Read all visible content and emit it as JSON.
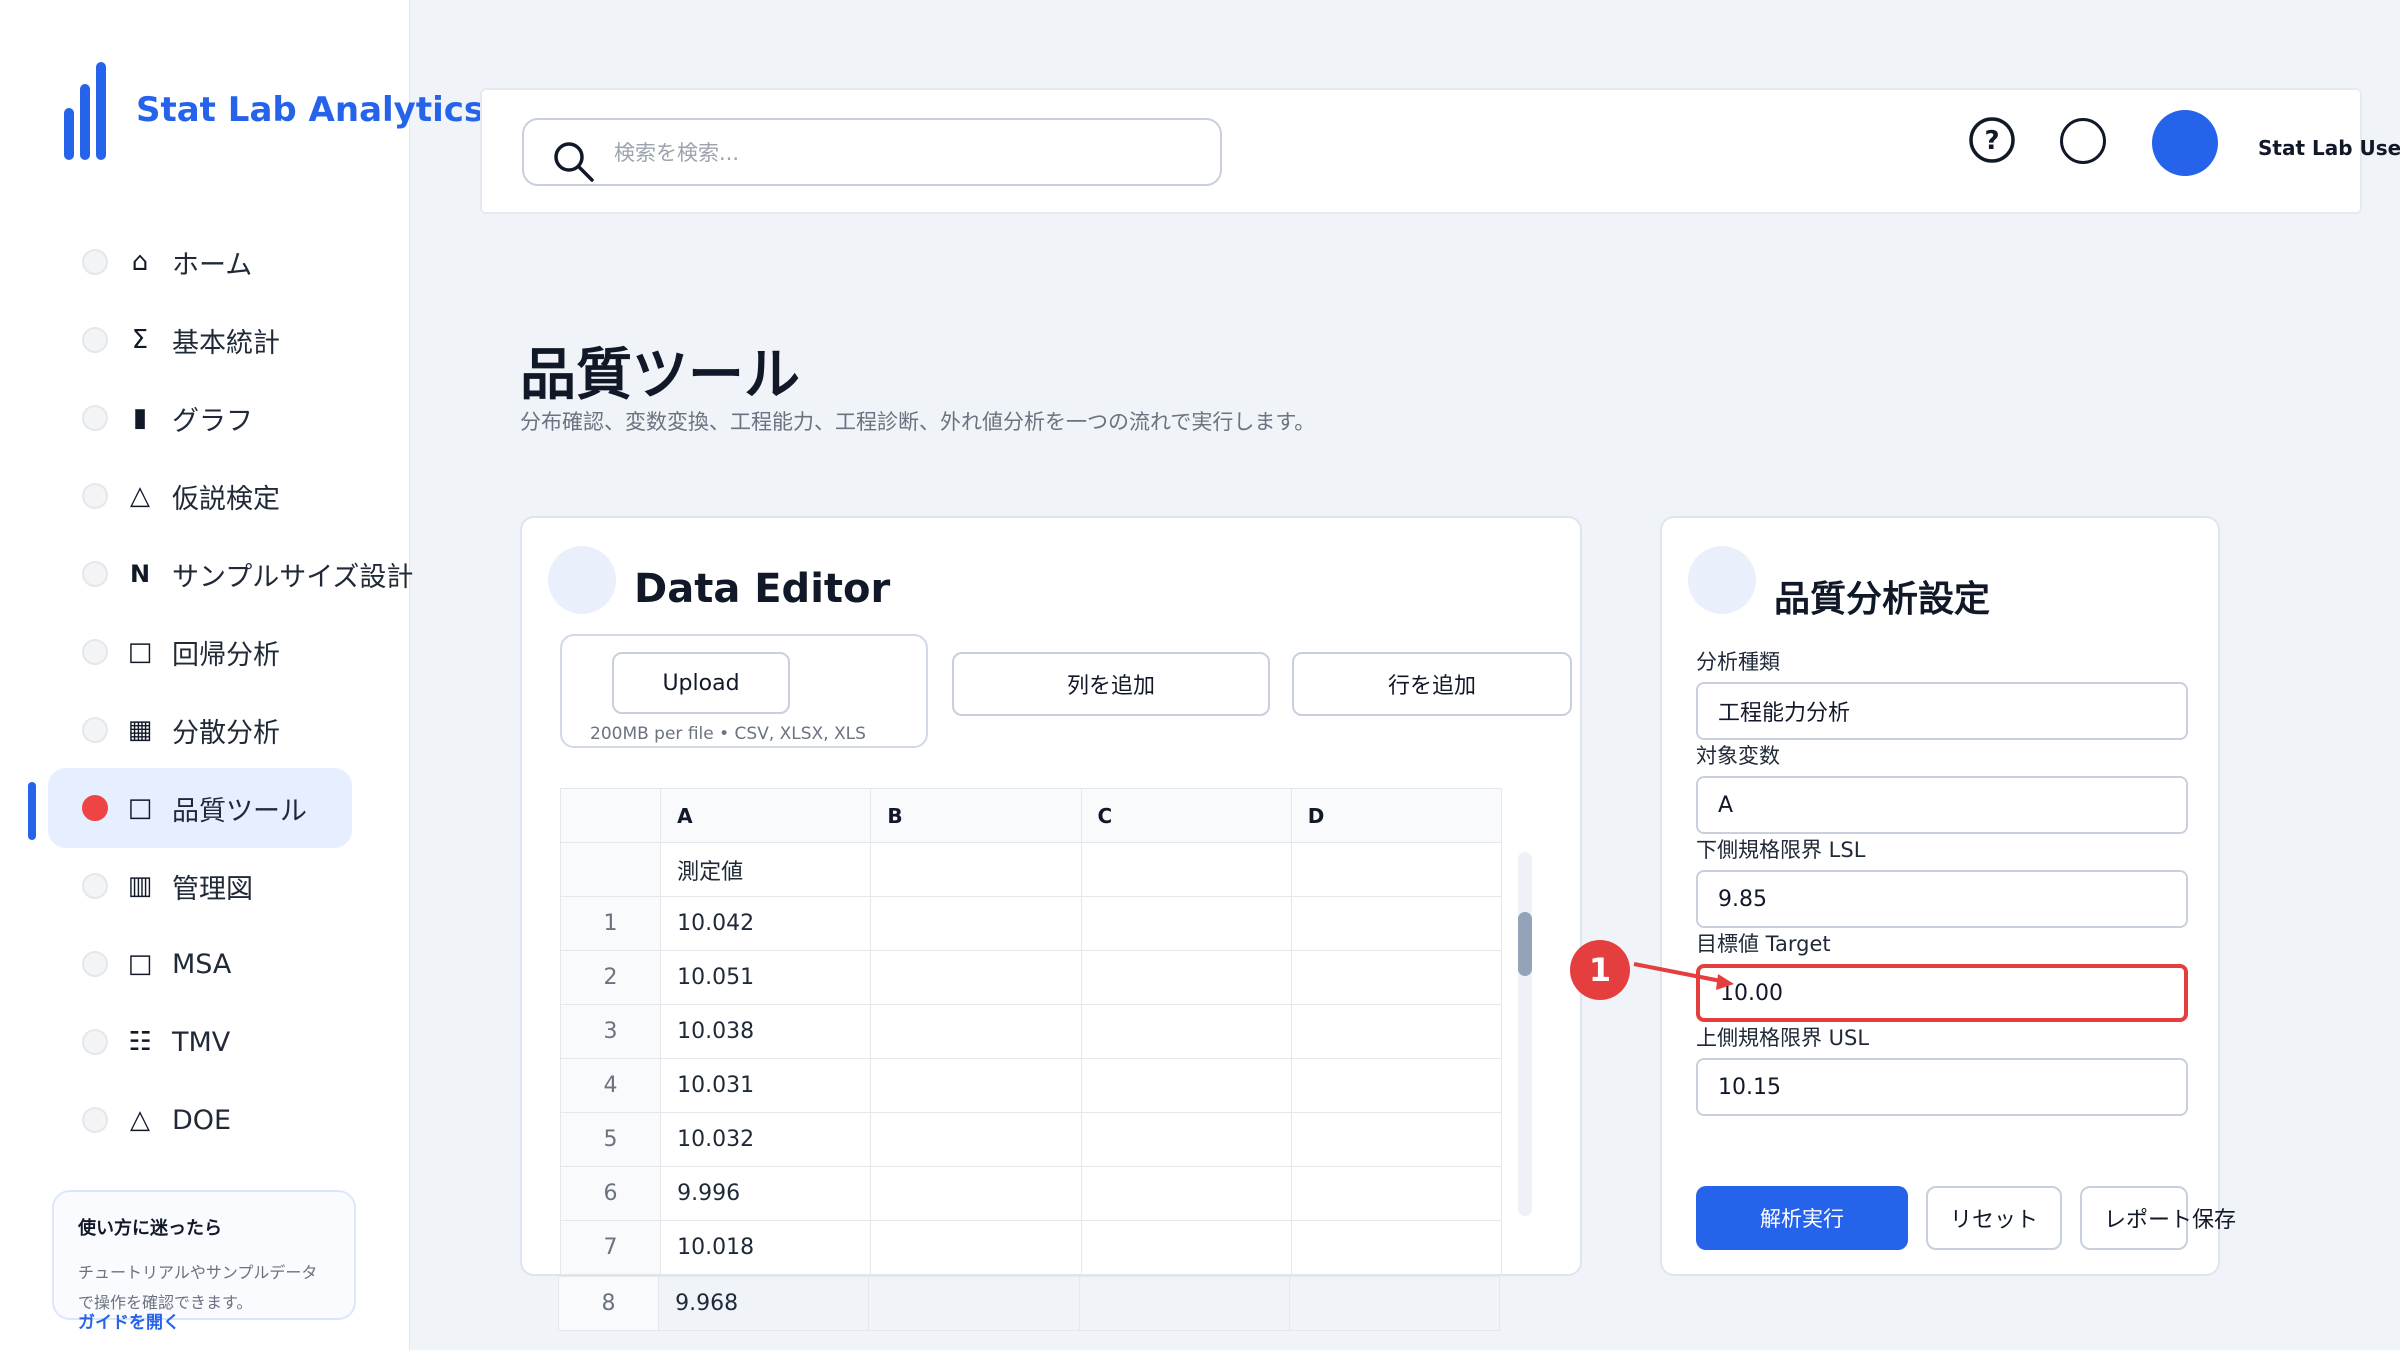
{
  "brand": {
    "name": "Stat Lab Analytics"
  },
  "sidebar": {
    "items": [
      {
        "icon": "⌂",
        "label": "ホーム"
      },
      {
        "icon": "Σ",
        "label": "基本統計"
      },
      {
        "icon": "▮",
        "label": "グラフ"
      },
      {
        "icon": "△",
        "label": "仮説検定"
      },
      {
        "icon": "N",
        "label": "サンプルサイズ設計"
      },
      {
        "icon": "□",
        "label": "回帰分析"
      },
      {
        "icon": "▦",
        "label": "分散分析"
      },
      {
        "icon": "□",
        "label": "品質ツール",
        "active": true
      },
      {
        "icon": "▥",
        "label": "管理図"
      },
      {
        "icon": "□",
        "label": "MSA"
      },
      {
        "icon": "☷",
        "label": "TMV"
      },
      {
        "icon": "△",
        "label": "DOE"
      }
    ],
    "help": {
      "title": "使い方に迷ったら",
      "text": "チュートリアルやサンプルデータで操作を確認できます。",
      "link": "ガイドを開く"
    }
  },
  "header": {
    "search_placeholder": "検索を検索...",
    "user_name": "Stat Lab User"
  },
  "page": {
    "title": "品質ツール",
    "subtitle": "分布確認、変数変換、工程能力、工程診断、外れ値分析を一つの流れで実行します。"
  },
  "editor": {
    "title": "Data Editor",
    "upload_label": "Upload",
    "upload_hint": "200MB per file • CSV, XLSX, XLS",
    "add_column": "列を追加",
    "add_row": "行を追加",
    "columns": [
      "A",
      "B",
      "C",
      "D"
    ],
    "header_row": "測定値",
    "rows": [
      {
        "n": "1",
        "a": "10.042"
      },
      {
        "n": "2",
        "a": "10.051"
      },
      {
        "n": "3",
        "a": "10.038"
      },
      {
        "n": "4",
        "a": "10.031"
      },
      {
        "n": "5",
        "a": "10.032"
      },
      {
        "n": "6",
        "a": "9.996"
      },
      {
        "n": "7",
        "a": "10.018"
      },
      {
        "n": "8",
        "a": "9.968"
      }
    ]
  },
  "settings": {
    "title": "品質分析設定",
    "analysis_type_label": "分析種類",
    "analysis_type": "工程能力分析",
    "variable_label": "対象変数",
    "variable": "A",
    "lsl_label": "下側規格限界 LSL",
    "lsl": "9.85",
    "target_label": "目標値 Target",
    "target": "10.00",
    "usl_label": "上側規格限界 USL",
    "usl": "10.15",
    "run_label": "解析実行",
    "reset_label": "リセット",
    "save_label": "レポート保存"
  },
  "annotation": {
    "marker": "1"
  },
  "colors": {
    "accent": "#2563eb",
    "marker": "#e53e3e"
  }
}
